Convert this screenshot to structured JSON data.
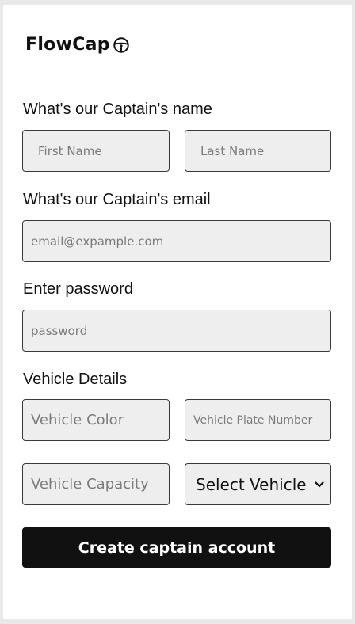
{
  "brand": {
    "name": "FlowCap",
    "icon": "steering-wheel-icon"
  },
  "name_section": {
    "label": "What's our Captain's name",
    "first_name_placeholder": "First Name",
    "last_name_placeholder": "Last Name"
  },
  "email_section": {
    "label": "What's our Captain's email",
    "email_placeholder": "email@expample.com"
  },
  "password_section": {
    "label": "Enter password",
    "password_placeholder": "password"
  },
  "vehicle_section": {
    "label": "Vehicle Details",
    "color_placeholder": "Vehicle Color",
    "plate_placeholder": "Vehicle Plate Number",
    "capacity_placeholder": "Vehicle Capacity",
    "type_select_value": "Select Vehicle"
  },
  "submit": {
    "label": "Create captain account"
  }
}
